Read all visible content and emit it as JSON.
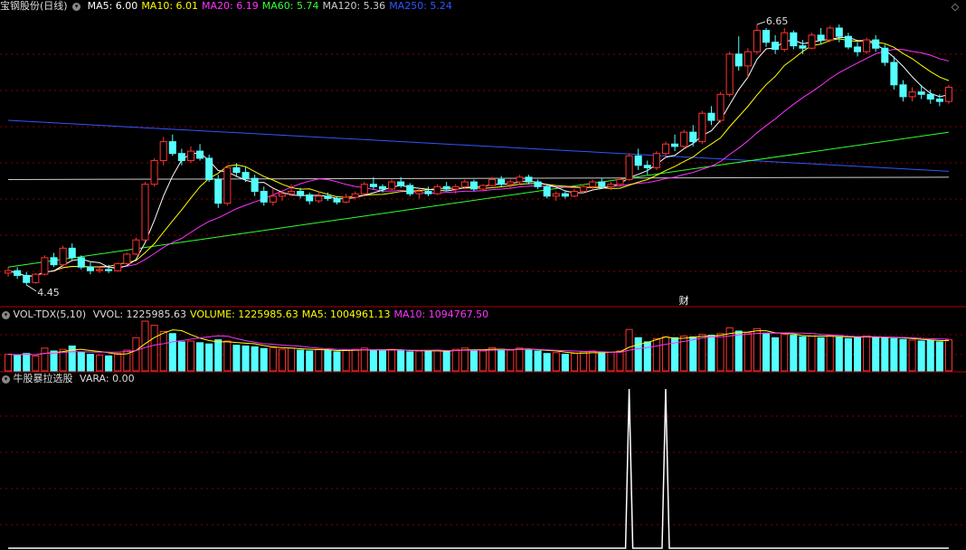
{
  "main_header": {
    "title": "宝钢股份(日线)",
    "ma_labels": [
      {
        "text": "MA5: 6.00",
        "color": "#ffffff"
      },
      {
        "text": "MA10: 6.01",
        "color": "#ffff00"
      },
      {
        "text": "MA20: 6.19",
        "color": "#ff33ff"
      },
      {
        "text": "MA60: 5.74",
        "color": "#33ff33"
      },
      {
        "text": "MA120: 5.36",
        "color": "#cccccc"
      },
      {
        "text": "MA250: 5.24",
        "color": "#3355ff"
      }
    ]
  },
  "vol_header": {
    "name": "VOL-TDX(5,10)",
    "items": [
      {
        "text": "VVOL: 1225985.63",
        "color": "#dddddd"
      },
      {
        "text": "VOLUME: 1225985.63",
        "color": "#ffff00"
      },
      {
        "text": "MA5: 1004961.13",
        "color": "#ffff00"
      },
      {
        "text": "MA10: 1094767.50",
        "color": "#ff33ff"
      }
    ]
  },
  "ind_header": {
    "name": "牛股暴拉选股",
    "items": [
      {
        "text": "VARA: 0.00",
        "color": "#dddddd"
      }
    ]
  },
  "annotations": {
    "high": "6.65",
    "low": "4.45",
    "cai_marker": "财"
  },
  "colors": {
    "up": "#ff3232",
    "down": "#54ffff",
    "grid": "#8b0000",
    "ma5": "#ffffff",
    "ma10": "#ffff00",
    "ma20": "#ff33ff",
    "ma60": "#33ff33",
    "ma120": "#cccccc",
    "ma250": "#3355ff"
  },
  "chart_data": {
    "type": "candlestick",
    "price_high": 6.65,
    "price_low": 4.45,
    "ohlc": [
      [
        4.55,
        4.6,
        4.52,
        4.57
      ],
      [
        4.57,
        4.6,
        4.5,
        4.53
      ],
      [
        4.53,
        4.56,
        4.45,
        4.47
      ],
      [
        4.47,
        4.55,
        4.46,
        4.54
      ],
      [
        4.54,
        4.7,
        4.53,
        4.68
      ],
      [
        4.68,
        4.72,
        4.6,
        4.62
      ],
      [
        4.62,
        4.78,
        4.61,
        4.76
      ],
      [
        4.76,
        4.8,
        4.66,
        4.68
      ],
      [
        4.68,
        4.7,
        4.58,
        4.6
      ],
      [
        4.6,
        4.64,
        4.54,
        4.57
      ],
      [
        4.57,
        4.6,
        4.55,
        4.58
      ],
      [
        4.58,
        4.62,
        4.55,
        4.57
      ],
      [
        4.57,
        4.64,
        4.56,
        4.63
      ],
      [
        4.63,
        4.72,
        4.62,
        4.71
      ],
      [
        4.71,
        4.85,
        4.7,
        4.83
      ],
      [
        4.83,
        5.32,
        4.82,
        5.3
      ],
      [
        5.3,
        5.52,
        5.28,
        5.5
      ],
      [
        5.5,
        5.7,
        5.46,
        5.66
      ],
      [
        5.66,
        5.72,
        5.54,
        5.56
      ],
      [
        5.56,
        5.6,
        5.46,
        5.5
      ],
      [
        5.5,
        5.62,
        5.48,
        5.58
      ],
      [
        5.58,
        5.64,
        5.5,
        5.52
      ],
      [
        5.52,
        5.55,
        5.32,
        5.34
      ],
      [
        5.34,
        5.38,
        5.1,
        5.14
      ],
      [
        5.14,
        5.46,
        5.12,
        5.44
      ],
      [
        5.44,
        5.48,
        5.36,
        5.4
      ],
      [
        5.4,
        5.45,
        5.32,
        5.35
      ],
      [
        5.35,
        5.38,
        5.2,
        5.24
      ],
      [
        5.24,
        5.28,
        5.12,
        5.15
      ],
      [
        5.15,
        5.26,
        5.12,
        5.2
      ],
      [
        5.2,
        5.25,
        5.16,
        5.22
      ],
      [
        5.22,
        5.3,
        5.2,
        5.24
      ],
      [
        5.24,
        5.27,
        5.18,
        5.21
      ],
      [
        5.21,
        5.23,
        5.13,
        5.16
      ],
      [
        5.16,
        5.24,
        5.14,
        5.2
      ],
      [
        5.2,
        5.23,
        5.16,
        5.18
      ],
      [
        5.18,
        5.2,
        5.13,
        5.15
      ],
      [
        5.15,
        5.22,
        5.14,
        5.19
      ],
      [
        5.19,
        5.24,
        5.17,
        5.22
      ],
      [
        5.22,
        5.32,
        5.21,
        5.3
      ],
      [
        5.3,
        5.36,
        5.26,
        5.28
      ],
      [
        5.28,
        5.3,
        5.23,
        5.26
      ],
      [
        5.26,
        5.34,
        5.25,
        5.32
      ],
      [
        5.32,
        5.36,
        5.27,
        5.29
      ],
      [
        5.29,
        5.31,
        5.2,
        5.22
      ],
      [
        5.22,
        5.26,
        5.18,
        5.24
      ],
      [
        5.24,
        5.28,
        5.2,
        5.22
      ],
      [
        5.22,
        5.3,
        5.21,
        5.28
      ],
      [
        5.28,
        5.32,
        5.24,
        5.26
      ],
      [
        5.26,
        5.3,
        5.22,
        5.28
      ],
      [
        5.28,
        5.34,
        5.26,
        5.32
      ],
      [
        5.32,
        5.34,
        5.24,
        5.26
      ],
      [
        5.26,
        5.3,
        5.24,
        5.29
      ],
      [
        5.29,
        5.36,
        5.28,
        5.34
      ],
      [
        5.34,
        5.37,
        5.28,
        5.3
      ],
      [
        5.3,
        5.34,
        5.27,
        5.32
      ],
      [
        5.32,
        5.38,
        5.3,
        5.36
      ],
      [
        5.36,
        5.38,
        5.3,
        5.32
      ],
      [
        5.32,
        5.34,
        5.26,
        5.28
      ],
      [
        5.28,
        5.3,
        5.18,
        5.2
      ],
      [
        5.2,
        5.24,
        5.16,
        5.22
      ],
      [
        5.22,
        5.25,
        5.18,
        5.2
      ],
      [
        5.2,
        5.26,
        5.19,
        5.24
      ],
      [
        5.24,
        5.3,
        5.22,
        5.28
      ],
      [
        5.28,
        5.34,
        5.26,
        5.32
      ],
      [
        5.32,
        5.35,
        5.26,
        5.28
      ],
      [
        5.28,
        5.32,
        5.25,
        5.3
      ],
      [
        5.3,
        5.36,
        5.28,
        5.34
      ],
      [
        5.34,
        5.56,
        5.33,
        5.54
      ],
      [
        5.54,
        5.6,
        5.42,
        5.46
      ],
      [
        5.46,
        5.5,
        5.38,
        5.44
      ],
      [
        5.44,
        5.58,
        5.42,
        5.56
      ],
      [
        5.56,
        5.66,
        5.54,
        5.64
      ],
      [
        5.64,
        5.72,
        5.58,
        5.62
      ],
      [
        5.62,
        5.76,
        5.6,
        5.74
      ],
      [
        5.74,
        5.8,
        5.62,
        5.66
      ],
      [
        5.66,
        5.92,
        5.64,
        5.9
      ],
      [
        5.9,
        5.96,
        5.8,
        5.84
      ],
      [
        5.84,
        6.08,
        5.82,
        6.06
      ],
      [
        6.06,
        6.42,
        6.04,
        6.4
      ],
      [
        6.4,
        6.55,
        6.26,
        6.3
      ],
      [
        6.3,
        6.45,
        6.2,
        6.42
      ],
      [
        6.42,
        6.65,
        6.4,
        6.6
      ],
      [
        6.6,
        6.62,
        6.46,
        6.5
      ],
      [
        6.5,
        6.56,
        6.4,
        6.44
      ],
      [
        6.44,
        6.62,
        6.42,
        6.58
      ],
      [
        6.58,
        6.6,
        6.44,
        6.47
      ],
      [
        6.47,
        6.52,
        6.4,
        6.45
      ],
      [
        6.45,
        6.58,
        6.44,
        6.56
      ],
      [
        6.56,
        6.62,
        6.48,
        6.52
      ],
      [
        6.52,
        6.64,
        6.5,
        6.62
      ],
      [
        6.62,
        6.65,
        6.5,
        6.55
      ],
      [
        6.55,
        6.58,
        6.44,
        6.46
      ],
      [
        6.46,
        6.5,
        6.38,
        6.42
      ],
      [
        6.42,
        6.54,
        6.4,
        6.52
      ],
      [
        6.52,
        6.56,
        6.42,
        6.45
      ],
      [
        6.45,
        6.48,
        6.3,
        6.33
      ],
      [
        6.33,
        6.38,
        6.1,
        6.14
      ],
      [
        6.14,
        6.18,
        6.0,
        6.04
      ],
      [
        6.04,
        6.12,
        6.0,
        6.08
      ],
      [
        6.08,
        6.14,
        6.02,
        6.06
      ],
      [
        6.06,
        6.1,
        5.98,
        6.02
      ],
      [
        6.02,
        6.06,
        5.96,
        6.0
      ],
      [
        6.0,
        6.14,
        5.98,
        6.12
      ]
    ],
    "volume": [
      40,
      38,
      42,
      36,
      55,
      48,
      52,
      60,
      45,
      40,
      38,
      36,
      42,
      50,
      80,
      120,
      110,
      95,
      90,
      70,
      72,
      68,
      65,
      75,
      72,
      62,
      60,
      58,
      54,
      56,
      52,
      55,
      50,
      48,
      52,
      50,
      46,
      50,
      52,
      55,
      50,
      48,
      52,
      50,
      46,
      48,
      47,
      50,
      48,
      52,
      55,
      50,
      48,
      56,
      52,
      50,
      55,
      52,
      48,
      42,
      44,
      40,
      42,
      46,
      48,
      44,
      45,
      48,
      100,
      80,
      70,
      78,
      82,
      80,
      84,
      82,
      88,
      86,
      90,
      104,
      96,
      92,
      102,
      90,
      80,
      88,
      86,
      82,
      84,
      80,
      86,
      82,
      78,
      80,
      84,
      82,
      80,
      78,
      76,
      74,
      72,
      74,
      70,
      75
    ],
    "vara": [
      0,
      0,
      0,
      0,
      0,
      0,
      0,
      0,
      0,
      0,
      0,
      0,
      0,
      0,
      0,
      0,
      0,
      0,
      0,
      0,
      0,
      0,
      0,
      0,
      0,
      0,
      0,
      0,
      0,
      0,
      0,
      0,
      0,
      0,
      0,
      0,
      0,
      0,
      0,
      0,
      0,
      0,
      0,
      0,
      0,
      0,
      0,
      0,
      0,
      0,
      0,
      0,
      0,
      0,
      0,
      0,
      0,
      0,
      0,
      0,
      0,
      0,
      0,
      0,
      0,
      0,
      0,
      0,
      0,
      0,
      0,
      0,
      0,
      0,
      0,
      0,
      0,
      0,
      0,
      0,
      0,
      0,
      0,
      0,
      0,
      0,
      0,
      0,
      0,
      0,
      0,
      0,
      0,
      0,
      0,
      0,
      0,
      0,
      0,
      0,
      0,
      0,
      0,
      0
    ],
    "vara_spikes": [
      68,
      72
    ],
    "ma250": [
      5.84,
      5.41
    ],
    "ma120": [
      5.34,
      5.36
    ],
    "ma60": [
      4.6,
      5.74
    ]
  }
}
